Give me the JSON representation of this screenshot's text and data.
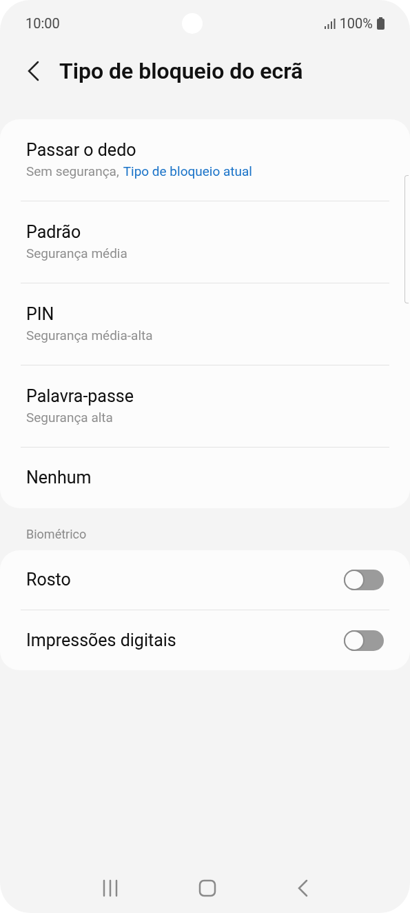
{
  "status_bar": {
    "time": "10:00",
    "battery": "100%"
  },
  "header": {
    "title": "Tipo de bloqueio do ecrã"
  },
  "options": [
    {
      "title": "Passar o dedo",
      "subtitle": "Sem segurança,",
      "note": "Tipo de bloqueio atual"
    },
    {
      "title": "Padrão",
      "subtitle": "Segurança média"
    },
    {
      "title": "PIN",
      "subtitle": "Segurança média-alta"
    },
    {
      "title": "Palavra-passe",
      "subtitle": "Segurança alta"
    },
    {
      "title": "Nenhum"
    }
  ],
  "biometric": {
    "heading": "Biométrico",
    "items": [
      {
        "label": "Rosto",
        "on": false
      },
      {
        "label": "Impressões digitais",
        "on": false
      }
    ]
  }
}
